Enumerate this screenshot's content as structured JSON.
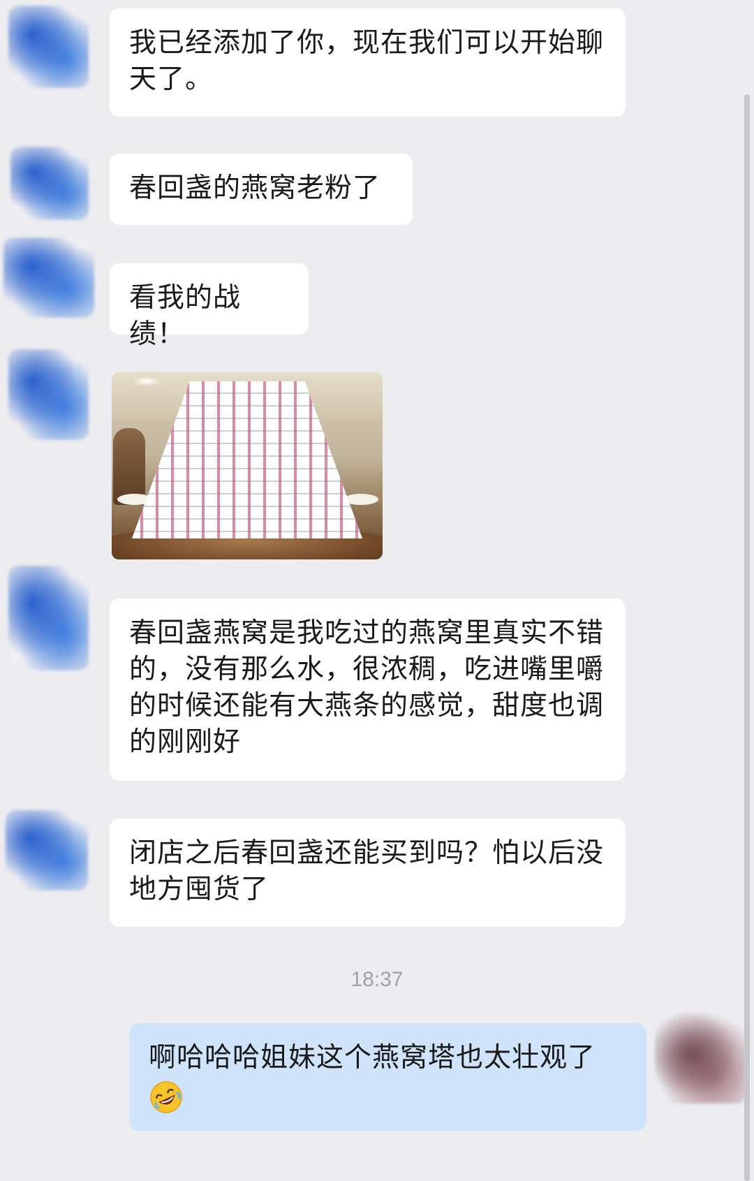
{
  "messages": [
    {
      "sender": "contact",
      "type": "text",
      "text": "我已经添加了你，现在我们可以开始聊天了。"
    },
    {
      "sender": "contact",
      "type": "text",
      "text": "春回盏的燕窝老粉了"
    },
    {
      "sender": "contact",
      "type": "text",
      "text": "看我的战绩！"
    },
    {
      "sender": "contact",
      "type": "image"
    },
    {
      "sender": "contact",
      "type": "text",
      "text": "春回盏燕窝是我吃过的燕窝里真实不错的，没有那么水，很浓稠，吃进嘴里嚼的时候还能有大燕条的感觉，甜度也调的刚刚好"
    },
    {
      "sender": "contact",
      "type": "text",
      "text": "闭店之后春回盏还能买到吗？怕以后没地方囤货了"
    },
    {
      "sender": "self",
      "type": "text",
      "text": "啊哈哈哈姐妹这个燕窝塔也太壮观了",
      "emoji": "rolling-on-the-floor-laughing-emoji"
    }
  ],
  "timestamp": "18:37",
  "colors": {
    "background": "#ededf0",
    "incoming_bubble": "#ffffff",
    "outgoing_bubble": "#cfe4fb",
    "timestamp_text": "#a0a0a6"
  }
}
